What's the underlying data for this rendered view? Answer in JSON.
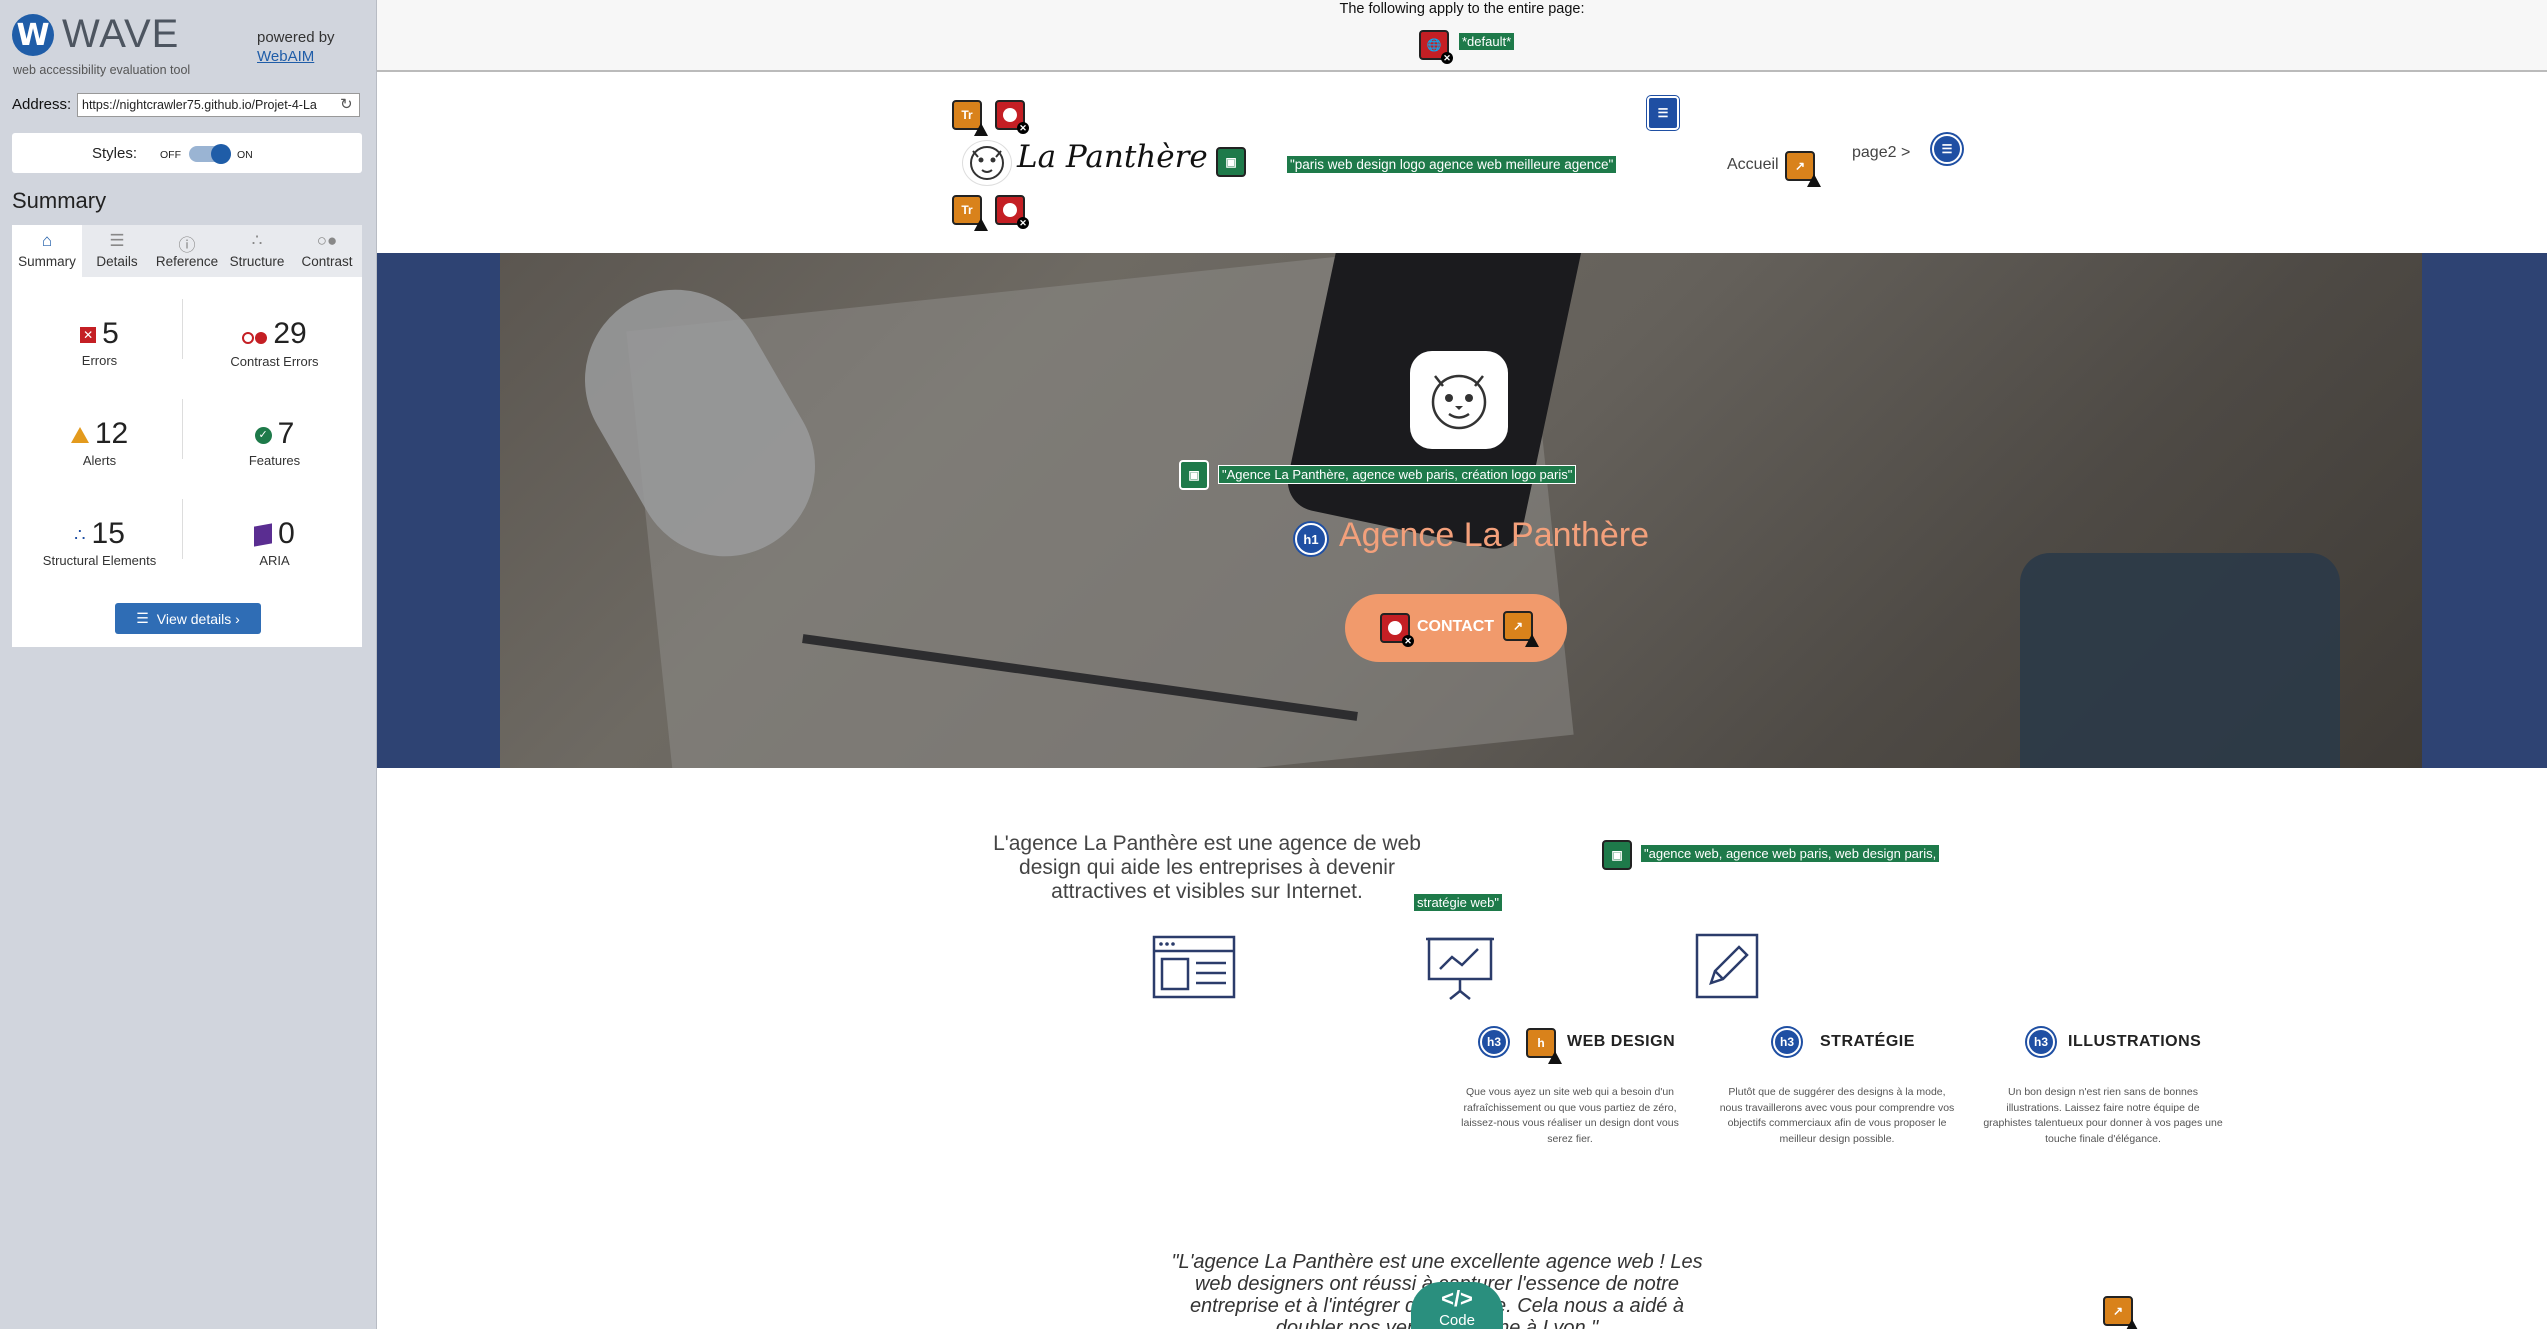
{
  "sidebar": {
    "logo_letter": "W",
    "app_name": "WAVE",
    "tagline": "web accessibility evaluation tool",
    "powered_by": "powered by",
    "webaim_link": "WebAIM",
    "address_label": "Address:",
    "address_value": "https://nightcrawler75.github.io/Projet-4-La",
    "styles_label": "Styles:",
    "styles_off": "OFF",
    "styles_on": "ON",
    "styles_state_on": true,
    "summary_title": "Summary",
    "tabs": [
      {
        "label": "Summary",
        "icon": "home-icon",
        "active": true
      },
      {
        "label": "Details",
        "icon": "list-icon",
        "active": false
      },
      {
        "label": "Reference",
        "icon": "info-icon",
        "active": false
      },
      {
        "label": "Structure",
        "icon": "structure-icon",
        "active": false
      },
      {
        "label": "Contrast",
        "icon": "contrast-icon",
        "active": false
      }
    ],
    "stats": {
      "errors": {
        "value": "5",
        "label": "Errors"
      },
      "contrast_errors": {
        "value": "29",
        "label": "Contrast Errors"
      },
      "alerts": {
        "value": "12",
        "label": "Alerts"
      },
      "features": {
        "value": "7",
        "label": "Features"
      },
      "structural": {
        "value": "15",
        "label": "Structural Elements"
      },
      "aria": {
        "value": "0",
        "label": "ARIA"
      }
    },
    "view_details": "View details ›"
  },
  "page": {
    "top_notice": "The following apply to the entire page:",
    "default_tag": "*default*",
    "logo_text": "La Panthère",
    "logo_alt": "\"paris web design logo agence web meilleure agence\"",
    "nav": {
      "accueil": "Accueil",
      "page2": "page2 >"
    },
    "hero": {
      "logo_alt": "\"Agence La Panthère, agence web paris, création logo paris\"",
      "title": "Agence La Panthère",
      "h1_badge": "h1",
      "contact": "CONTACT"
    },
    "intro_text": "L'agence La Panthère est une agence de web design qui aide les entreprises à devenir attractives et visibles sur Internet.",
    "intro_alt_line1": "\"agence web, agence web paris, web design paris,",
    "intro_alt_line2": "stratégie web\"",
    "services": [
      {
        "title": "WEB DESIGN",
        "badge": "h3",
        "text": "Que vous ayez un site web qui a besoin d'un rafraîchissement ou que vous partiez de zéro, laissez-nous vous réaliser un design dont vous serez fier."
      },
      {
        "title": "STRATÉGIE",
        "badge": "h3",
        "text": "Plutôt que de suggérer des designs à la mode, nous travaillerons avec vous pour comprendre vos objectifs commerciaux afin de vous proposer le meilleur design possible."
      },
      {
        "title": "ILLUSTRATIONS",
        "badge": "h3",
        "text": "Un bon design n'est rien sans de bonnes illustrations. Laissez faire notre équipe de graphistes talentueux pour donner à vos pages une touche finale d'élégance."
      }
    ],
    "quote": "\"L'agence La Panthère est une excellente agence web ! Les web designers ont réussi à capturer l'essence de notre entreprise et à l'intégrer dans le site. Cela nous a aidé à doubler nos ventes en ligne à Lyon.\"",
    "code_button": "Code",
    "code_glyph": "</>",
    "badge_tr": "Tr",
    "badge_h": "h"
  },
  "colors": {
    "wave_blue": "#1f5da8",
    "error_red": "#c41f24",
    "alert_orange": "#d9821b",
    "feature_green": "#1e7a4a",
    "structure_blue": "#1f4fa3",
    "aria_purple": "#5a2d91",
    "hero_title": "#f3a07b",
    "contact_bg": "#f19a6c",
    "code_teal": "#2a8f7e"
  }
}
